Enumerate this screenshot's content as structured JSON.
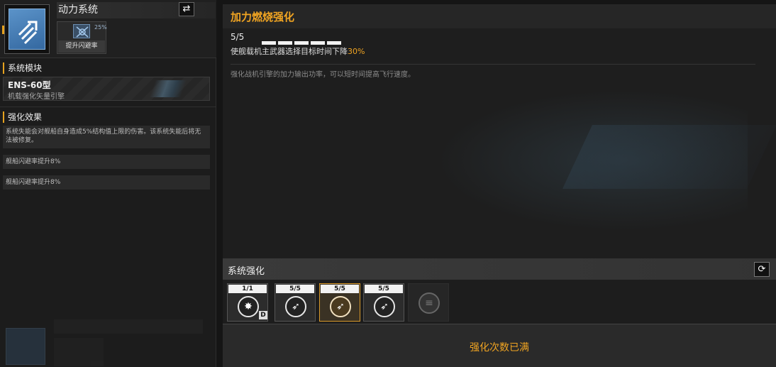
{
  "system": {
    "title": "动力系统",
    "swap_icon": "swap-arrows-icon",
    "chip": {
      "percent": "25%",
      "label": "提升闪避率"
    }
  },
  "module": {
    "heading": "系统模块",
    "name": "ENS-60型",
    "subtitle": "机载强化矢量引擎"
  },
  "effects": {
    "heading": "强化效果",
    "items": [
      "系统失能会对舰船自身造成5%结构值上限的伤害。该系统失能后将无法被修复。",
      "舰船闪避率提升8%",
      "舰船闪避率提升8%"
    ]
  },
  "upgrade": {
    "title": "加力燃烧强化",
    "level_current": "5",
    "level_max": "/5",
    "pips_filled": 5,
    "pips_total": 5,
    "desc_prefix": "使舰载机主武器选择目标时间下降",
    "desc_value": "30%",
    "flavor": "强化战机引擎的加力输出功率，可以短时间提高飞行速度。"
  },
  "system_enhance": {
    "heading": "系统强化",
    "refresh_icon": "refresh-icon",
    "slots": [
      {
        "cap": "1/1",
        "tag": "D",
        "icon": "burst-icon",
        "selected": false
      },
      {
        "cap": "5/5",
        "tag": "",
        "icon": "jet-icon",
        "selected": false
      },
      {
        "cap": "5/5",
        "tag": "",
        "icon": "jet-icon",
        "selected": true
      },
      {
        "cap": "5/5",
        "tag": "",
        "icon": "jet-icon",
        "selected": false
      },
      {
        "cap": "",
        "tag": "",
        "icon": "locked-icon",
        "selected": false
      }
    ]
  },
  "status": {
    "full_text": "强化次数已满"
  },
  "colors": {
    "accent": "#f0a422",
    "icon_blue": "#5b93c9"
  }
}
